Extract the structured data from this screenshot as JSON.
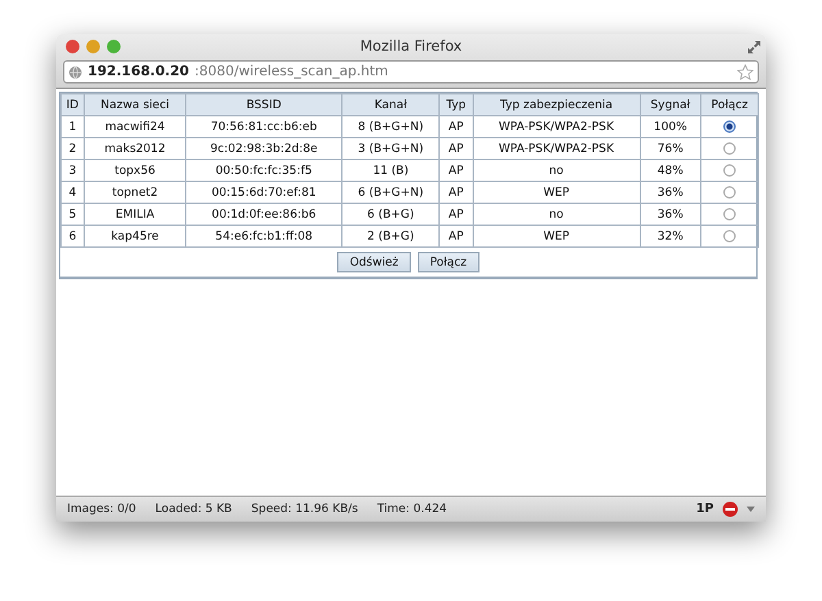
{
  "window": {
    "title": "Mozilla Firefox"
  },
  "address_bar": {
    "host": "192.168.0.20",
    "path": ":8080/wireless_scan_ap.htm"
  },
  "table": {
    "columns": [
      "ID",
      "Nazwa sieci",
      "BSSID",
      "Kanał",
      "Typ",
      "Typ zabezpieczenia",
      "Sygnał",
      "Połącz"
    ],
    "rows": [
      {
        "id": "1",
        "name": "macwifi24",
        "bssid": "70:56:81:cc:b6:eb",
        "channel": "8 (B+G+N)",
        "type": "AP",
        "security": "WPA-PSK/WPA2-PSK",
        "signal": "100%",
        "selected": true
      },
      {
        "id": "2",
        "name": "maks2012",
        "bssid": "9c:02:98:3b:2d:8e",
        "channel": "3 (B+G+N)",
        "type": "AP",
        "security": "WPA-PSK/WPA2-PSK",
        "signal": "76%",
        "selected": false
      },
      {
        "id": "3",
        "name": "topx56",
        "bssid": "00:50:fc:fc:35:f5",
        "channel": "11 (B)",
        "type": "AP",
        "security": "no",
        "signal": "48%",
        "selected": false
      },
      {
        "id": "4",
        "name": "topnet2",
        "bssid": "00:15:6d:70:ef:81",
        "channel": "6 (B+G+N)",
        "type": "AP",
        "security": "WEP",
        "signal": "36%",
        "selected": false
      },
      {
        "id": "5",
        "name": "EMILIA",
        "bssid": "00:1d:0f:ee:86:b6",
        "channel": "6 (B+G)",
        "type": "AP",
        "security": "no",
        "signal": "36%",
        "selected": false
      },
      {
        "id": "6",
        "name": "kap45re",
        "bssid": "54:e6:fc:b1:ff:08",
        "channel": "2 (B+G)",
        "type": "AP",
        "security": "WEP",
        "signal": "32%",
        "selected": false
      }
    ]
  },
  "buttons": [
    "Odśwież",
    "Połącz"
  ],
  "status_bar": {
    "items": [
      "Images: 0/0",
      "Loaded: 5 KB",
      "Speed: 11.96 KB/s",
      "Time: 0.424"
    ],
    "badge": "1P"
  }
}
